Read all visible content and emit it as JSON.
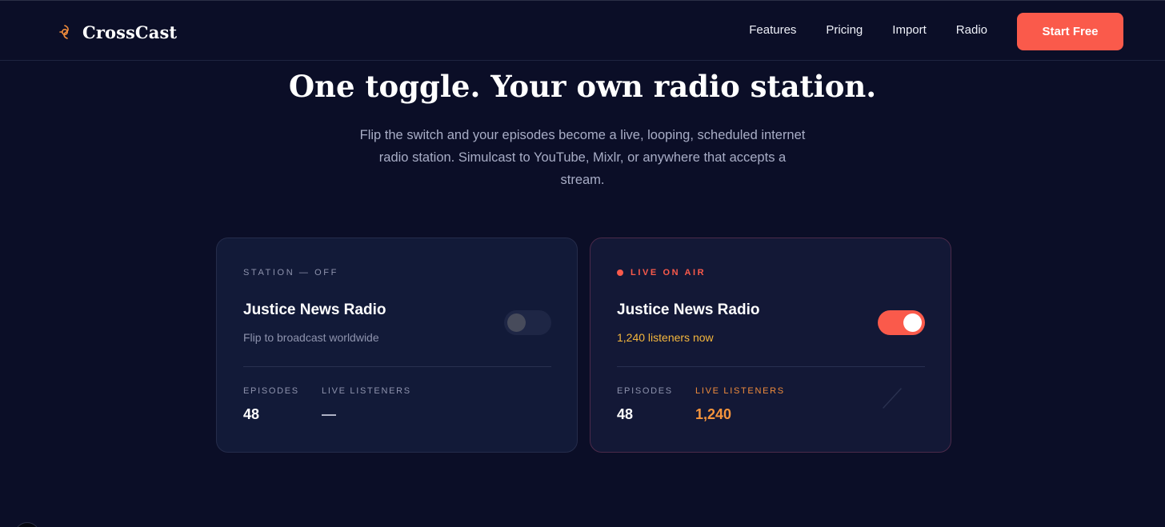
{
  "nav": {
    "brand_name": "CrossCast",
    "brand_icon": "crosscast-logo-icon",
    "links": [
      "Features",
      "Pricing",
      "Import",
      "Radio"
    ],
    "cta_label": "Start Free"
  },
  "hero": {
    "title": "One toggle. Your own radio station.",
    "subtitle": "Flip the switch and your episodes become a live, looping, scheduled internet radio station. Simulcast to YouTube, Mixlr, or anywhere that accepts a stream."
  },
  "cards": {
    "off": {
      "eyebrow": "STATION — OFF",
      "title": "Justice News Radio",
      "subtitle": "Flip to broadcast worldwide",
      "toggle_on": false,
      "episodes_label": "EPISODES",
      "episodes_value": "48",
      "listeners_label": "LIVE LISTENERS",
      "listeners_value": "—"
    },
    "live": {
      "eyebrow": "LIVE ON AIR",
      "title": "Justice News Radio",
      "subtitle": "1,240 listeners now",
      "toggle_on": true,
      "episodes_label": "EPISODES",
      "episodes_value": "48",
      "listeners_label": "LIVE LISTENERS",
      "listeners_value": "1,240"
    }
  },
  "colors": {
    "background": "#0b0e27",
    "card": "#121a38",
    "accent": "#fa5a4b",
    "live_subtitle": "#f5b73d",
    "live_listeners": "#f5943c",
    "muted_text": "#8e93ad"
  },
  "icons": [
    "crosscast-logo-icon",
    "live-dot-icon",
    "toggle-switch",
    "sparkline-icon"
  ]
}
